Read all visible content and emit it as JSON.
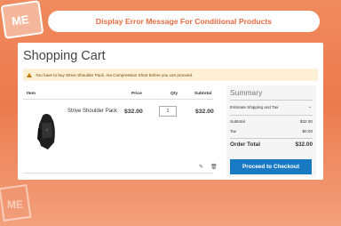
{
  "banner": {
    "title": "Display Error Message For Conditional Products"
  },
  "cart": {
    "title": "Shopping Cart",
    "notice": "You have to buy Strive Shoulder Pack, ma Compression Short before you can proceed.",
    "headers": {
      "item": "Item",
      "price": "Price",
      "qty": "Qty",
      "subtotal": "Subtotal"
    },
    "items": [
      {
        "name": "Strive Shoulder Pack",
        "price": "$32.00",
        "qty": "1",
        "subtotal": "$32.00"
      }
    ]
  },
  "summary": {
    "title": "Summary",
    "estimate_label": "Estimate Shipping and Tax",
    "subtotal_label": "Subtotal",
    "subtotal_value": "$32.00",
    "tax_label": "Tax",
    "tax_value": "$0.00",
    "total_label": "Order Total",
    "total_value": "$32.00",
    "checkout_label": "Proceed to Checkout"
  },
  "colors": {
    "accent": "#e66a40",
    "primary_button": "#1979c3",
    "notice_bg": "#fdf0d5"
  }
}
